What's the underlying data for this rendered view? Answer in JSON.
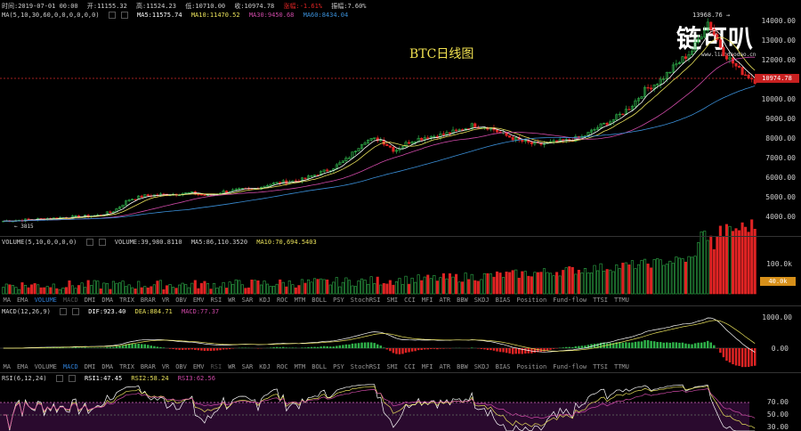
{
  "header": {
    "time": "时间:2019-07-01 00:00",
    "open": "开:11155.32",
    "high": "高:11524.23",
    "low": "低:10710.00",
    "close": "收:10974.78",
    "change": "涨幅:-1.61%",
    "amplitude": "振幅:7.60%"
  },
  "ma_line": {
    "params": "MA(5,10,30,60,0,0,0,0,0,0)",
    "ma5": "MA5:11575.74",
    "ma10": "MA10:11470.52",
    "ma30": "MA30:9450.68",
    "ma60": "MA60:8434.04"
  },
  "chart_title": "BTC日线图",
  "watermark": {
    "text": "链可叭",
    "url": "www.liandaodao.cn"
  },
  "price_axis": [
    "14000.00",
    "13000.00",
    "12000.00",
    "11000.00",
    "10000.00",
    "9000.00",
    "8000.00",
    "7000.00",
    "6000.00",
    "5000.00",
    "4000.00"
  ],
  "price_tag": "10974.78",
  "high_annotation": "13968.76 →",
  "low_annotation": "← 3815",
  "volume": {
    "params": "VOLUME(5,10,0,0,0,0)",
    "value": "VOLUME:39,980.8110",
    "ma5": "MA5:86,110.3520",
    "ma10": "MA10:70,694.5403",
    "axis": "100.0k",
    "tag": "40.0k"
  },
  "macd": {
    "params": "MACD(12,26,9)",
    "dif": "DIF:923.40",
    "dea": "DEA:884.71",
    "macd": "MACD:77.37",
    "axis": [
      "1000.00",
      "0.00"
    ]
  },
  "rsi": {
    "params": "RSI(6,12,24)",
    "rsi1": "RSI1:47.45",
    "rsi2": "RSI2:58.24",
    "rsi3": "RSI3:62.56",
    "axis": [
      "70.00",
      "50.00",
      "30.00"
    ]
  },
  "indicator_tabs": [
    "MA",
    "EMA",
    "VOLUME",
    "MACD",
    "DMI",
    "DMA",
    "TRIX",
    "BRAR",
    "VR",
    "OBV",
    "EMV",
    "RSI",
    "WR",
    "SAR",
    "KDJ",
    "ROC",
    "MTM",
    "BOLL",
    "PSY",
    "StochRSI",
    "SMI",
    "CCI",
    "MFI",
    "ATR",
    "BBW",
    "SKDJ",
    "BIAS",
    "Position",
    "Fund-flow",
    "TTSI",
    "TTMU"
  ],
  "tab_bars": [
    {
      "active": "VOLUME",
      "dim": [
        "MACD"
      ]
    },
    {
      "active": "MACD",
      "dim": [
        "RSI"
      ]
    }
  ],
  "colors": {
    "up": "#2fb14a",
    "down": "#e02424",
    "ma5": "#ffffff",
    "ma10": "#e8e05a",
    "ma30": "#d04aa8",
    "ma60": "#3a8fd8",
    "rsiFill": "#2a0a2e"
  },
  "chart_data": [
    {
      "type": "candlestick",
      "title": "BTC日线图",
      "ylim": [
        3600,
        14300
      ],
      "closes": [
        3815,
        3860,
        3900,
        3950,
        4000,
        4050,
        4100,
        4300,
        4900,
        5100,
        5150,
        5200,
        5250,
        5100,
        5300,
        5400,
        5450,
        5700,
        5800,
        5900,
        6200,
        6500,
        7000,
        7900,
        8000,
        7400,
        7900,
        8100,
        8200,
        8400,
        8700,
        8600,
        8200,
        7900,
        7700,
        7800,
        7900,
        8100,
        8600,
        9000,
        9600,
        10500,
        11000,
        11800,
        12500,
        13968,
        12400,
        11500,
        10974.78
      ]
    }
  ]
}
